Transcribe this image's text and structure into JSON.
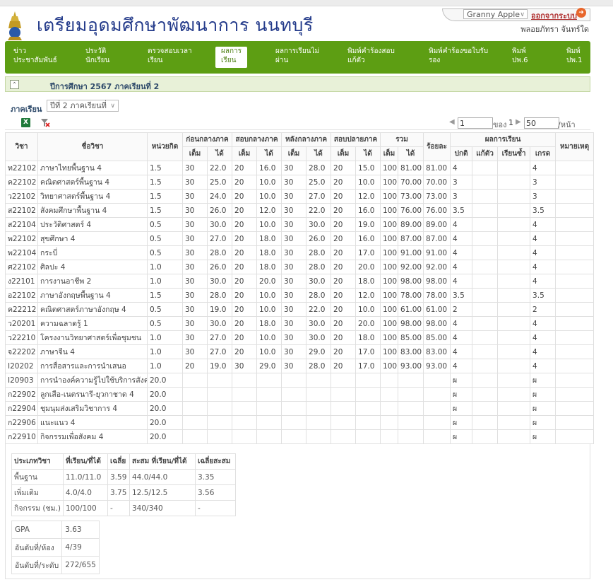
{
  "header": {
    "title": "เตรียมอุดมศึกษาพัฒนาการ นนทบุรี",
    "theme_value": "Granny Apple",
    "logout_label": "ออกจากระบบ",
    "username": "พลอยภัทรา จันทร์ใด"
  },
  "nav": [
    {
      "line1": "ข่าว",
      "line2": "ประชาสัมพันธ์"
    },
    {
      "line1": "ประวัติ",
      "line2": "นักเรียน"
    },
    {
      "line1": "ตรวจสอบเวลา",
      "line2": "เรียน"
    },
    {
      "line1": "ผลการ",
      "line2": "เรียน"
    },
    {
      "line1": "ผลการเรียนไม่",
      "line2": "ผ่าน"
    },
    {
      "line1": "พิมพ์คำร้องสอบ",
      "line2": "แก้ตัว"
    },
    {
      "line1": "พิมพ์คำร้องขอใบรับ",
      "line2": "รอง"
    },
    {
      "line1": "พิมพ์",
      "line2": "ปพ.6"
    },
    {
      "line1": "พิมพ์",
      "line2": "ปพ.1"
    }
  ],
  "section": {
    "title": "ปีการศึกษา 2567 ภาคเรียนที่ 2",
    "toggle": "⌃"
  },
  "term": {
    "label": "ภาคเรียน",
    "value": "ปีที่ 2 ภาคเรียนที่"
  },
  "toolbar": {
    "excel": "X"
  },
  "pager": {
    "page": "1",
    "of_label": "ของ",
    "total_pages": "1",
    "page_size": "50",
    "per_page_label": "/หน้า"
  },
  "table": {
    "headers": {
      "code": "วิชา",
      "name": "ชื่อวิชา",
      "credit": "หน่วยกิต",
      "g1": "ก่อนกลางภาค",
      "g2": "สอบกลางภาค",
      "g3": "หลังกลางภาค",
      "g4": "สอบปลายภาค",
      "g5": "รวม",
      "percent": "ร้อยละ",
      "result": "ผลการเรียน",
      "remark": "หมายเหตุ",
      "full": "เต็ม",
      "got": "ได้",
      "normal": "ปกติ",
      "retest": "แก้ตัว",
      "repeat": "เรียนซ้ำ",
      "grade": "เกรด"
    },
    "rows": [
      [
        "ท22102",
        "ภาษาไทยพื้นฐาน 4",
        "1.5",
        "30",
        "22.0",
        "20",
        "16.0",
        "30",
        "28.0",
        "20",
        "15.0",
        "100",
        "81.00",
        "81.00",
        "4",
        "",
        "",
        "4",
        ""
      ],
      [
        "ค22102",
        "คณิตศาสตร์พื้นฐาน 4",
        "1.5",
        "30",
        "25.0",
        "20",
        "10.0",
        "30",
        "25.0",
        "20",
        "10.0",
        "100",
        "70.00",
        "70.00",
        "3",
        "",
        "",
        "3",
        ""
      ],
      [
        "ว22102",
        "วิทยาศาสตร์พื้นฐาน 4",
        "1.5",
        "30",
        "24.0",
        "20",
        "10.0",
        "30",
        "27.0",
        "20",
        "12.0",
        "100",
        "73.00",
        "73.00",
        "3",
        "",
        "",
        "3",
        ""
      ],
      [
        "ส22102",
        "สังคมศึกษาพื้นฐาน 4",
        "1.5",
        "30",
        "26.0",
        "20",
        "12.0",
        "30",
        "22.0",
        "20",
        "16.0",
        "100",
        "76.00",
        "76.00",
        "3.5",
        "",
        "",
        "3.5",
        ""
      ],
      [
        "ส22104",
        "ประวัติศาสตร์ 4",
        "0.5",
        "30",
        "30.0",
        "20",
        "10.0",
        "30",
        "30.0",
        "20",
        "19.0",
        "100",
        "89.00",
        "89.00",
        "4",
        "",
        "",
        "4",
        ""
      ],
      [
        "พ22102",
        "สุขศึกษา 4",
        "0.5",
        "30",
        "27.0",
        "20",
        "18.0",
        "30",
        "26.0",
        "20",
        "16.0",
        "100",
        "87.00",
        "87.00",
        "4",
        "",
        "",
        "4",
        ""
      ],
      [
        "พ22104",
        "กระบี่",
        "0.5",
        "30",
        "28.0",
        "20",
        "18.0",
        "30",
        "28.0",
        "20",
        "17.0",
        "100",
        "91.00",
        "91.00",
        "4",
        "",
        "",
        "4",
        ""
      ],
      [
        "ศ22102",
        "ศิลปะ 4",
        "1.0",
        "30",
        "26.0",
        "20",
        "18.0",
        "30",
        "28.0",
        "20",
        "20.0",
        "100",
        "92.00",
        "92.00",
        "4",
        "",
        "",
        "4",
        ""
      ],
      [
        "ง22101",
        "การงานอาชีพ 2",
        "1.0",
        "30",
        "30.0",
        "20",
        "20.0",
        "30",
        "30.0",
        "20",
        "18.0",
        "100",
        "98.00",
        "98.00",
        "4",
        "",
        "",
        "4",
        ""
      ],
      [
        "อ22102",
        "ภาษาอังกฤษพื้นฐาน 4",
        "1.5",
        "30",
        "28.0",
        "20",
        "10.0",
        "30",
        "28.0",
        "20",
        "12.0",
        "100",
        "78.00",
        "78.00",
        "3.5",
        "",
        "",
        "3.5",
        ""
      ],
      [
        "ค22212",
        "คณิตศาสตร์ภาษาอังกฤษ 4",
        "0.5",
        "30",
        "19.0",
        "20",
        "10.0",
        "30",
        "22.0",
        "20",
        "10.0",
        "100",
        "61.00",
        "61.00",
        "2",
        "",
        "",
        "2",
        ""
      ],
      [
        "ว20201",
        "ความฉลาดรู้ 1",
        "0.5",
        "30",
        "30.0",
        "20",
        "18.0",
        "30",
        "30.0",
        "20",
        "20.0",
        "100",
        "98.00",
        "98.00",
        "4",
        "",
        "",
        "4",
        ""
      ],
      [
        "ว22210",
        "โครงงานวิทยาศาสตร์เพื่อชุมชน",
        "1.0",
        "30",
        "27.0",
        "20",
        "10.0",
        "30",
        "30.0",
        "20",
        "18.0",
        "100",
        "85.00",
        "85.00",
        "4",
        "",
        "",
        "4",
        ""
      ],
      [
        "จ22202",
        "ภาษาจีน 4",
        "1.0",
        "30",
        "27.0",
        "20",
        "10.0",
        "30",
        "29.0",
        "20",
        "17.0",
        "100",
        "83.00",
        "83.00",
        "4",
        "",
        "",
        "4",
        ""
      ],
      [
        "I20202",
        "การสื่อสารและการนำเสนอ",
        "1.0",
        "20",
        "19.0",
        "30",
        "29.0",
        "30",
        "28.0",
        "20",
        "17.0",
        "100",
        "93.00",
        "93.00",
        "4",
        "",
        "",
        "4",
        ""
      ],
      [
        "I20903",
        "การนำองค์ความรู้ไปใช้บริการสังคม",
        "20.0",
        "",
        "",
        "",
        "",
        "",
        "",
        "",
        "",
        "",
        "",
        "",
        "ผ",
        "",
        "",
        "ผ",
        ""
      ],
      [
        "ก22902",
        "ลูกเสือ-เนตรนารี-ยุวกาชาด 4",
        "20.0",
        "",
        "",
        "",
        "",
        "",
        "",
        "",
        "",
        "",
        "",
        "",
        "ผ",
        "",
        "",
        "ผ",
        ""
      ],
      [
        "ก22904",
        "ชุมนุมส่งเสริมวิชาการ 4",
        "20.0",
        "",
        "",
        "",
        "",
        "",
        "",
        "",
        "",
        "",
        "",
        "",
        "ผ",
        "",
        "",
        "ผ",
        ""
      ],
      [
        "ก22906",
        "แนะแนว 4",
        "20.0",
        "",
        "",
        "",
        "",
        "",
        "",
        "",
        "",
        "",
        "",
        "",
        "ผ",
        "",
        "",
        "ผ",
        ""
      ],
      [
        "ก22910",
        "กิจกรรมเพื่อสังคม 4",
        "20.0",
        "",
        "",
        "",
        "",
        "",
        "",
        "",
        "",
        "",
        "",
        "",
        "ผ",
        "",
        "",
        "ผ",
        ""
      ]
    ]
  },
  "summary": {
    "headers": [
      "ประเภทวิชา",
      "ที่เรียน/ที่ได้",
      "เฉลี่ย",
      "สะสม ที่เรียน/ที่ได้",
      "เฉลี่ยสะสม"
    ],
    "rows": [
      [
        "พื้นฐาน",
        "11.0/11.0",
        "3.59",
        "44.0/44.0",
        "3.35"
      ],
      [
        "เพิ่มเติม",
        "4.0/4.0",
        "3.75",
        "12.5/12.5",
        "3.56"
      ],
      [
        "กิจกรรม (ชม.)",
        "100/100",
        "-",
        "340/340",
        "-"
      ]
    ],
    "stats": [
      [
        "GPA",
        "3.63"
      ],
      [
        "อันดับที่/ห้อง",
        "4/39"
      ],
      [
        "อันดับที่/ระดับ",
        "272/655"
      ]
    ]
  }
}
